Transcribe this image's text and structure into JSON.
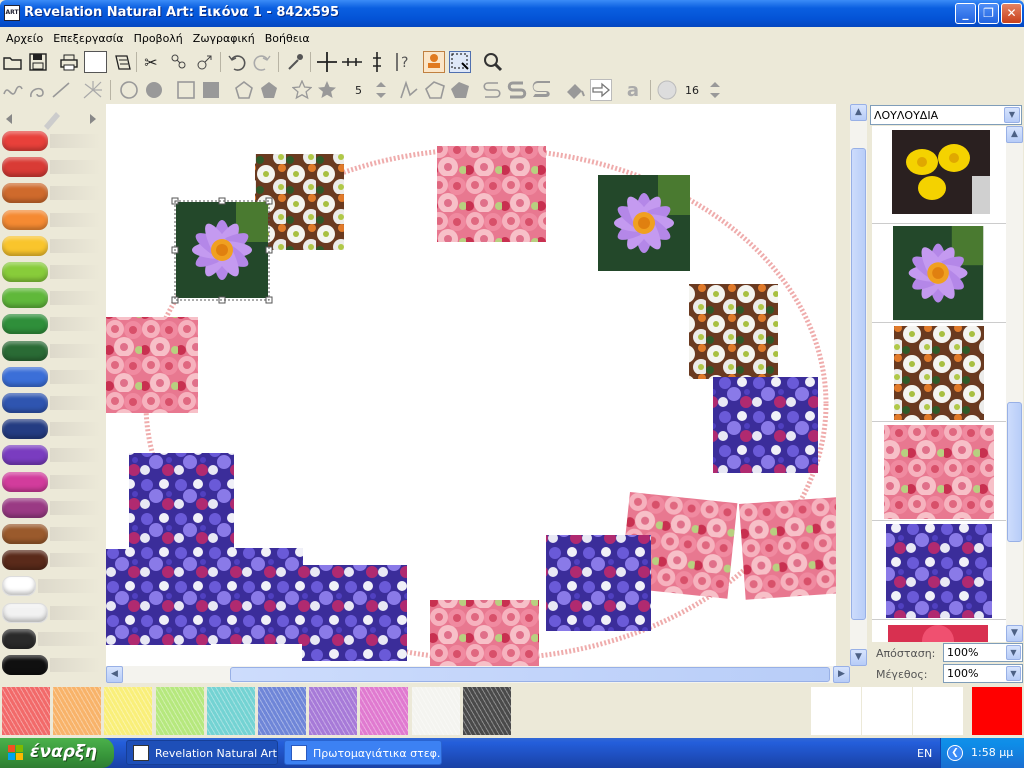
{
  "window": {
    "title": "Revelation Natural Art: Εικόνα 1 - 842x595",
    "app_icon_text": "ART"
  },
  "menu": [
    "Αρχείο",
    "Επεξεργασία",
    "Προβολή",
    "Ζωγραφική",
    "Βοήθεια"
  ],
  "toolbar2": {
    "brush_size": "5",
    "font_size": "16"
  },
  "right_panel": {
    "category": "ΛΟΥΛΟΥΔΙΑ",
    "distance_label": "Απόσταση:",
    "distance_value": "100%",
    "size_label": "Μέγεθος:",
    "size_value": "100%"
  },
  "crayon_colors": [
    "#e8403a",
    "#d93b35",
    "#cf6a2c",
    "#f58a32",
    "#f9c52c",
    "#88cc3a",
    "#60b83a",
    "#2f8f3a",
    "#2a6b35",
    "#3b6fd8",
    "#2f55b0",
    "#243c82",
    "#7a3cc0",
    "#d23c9c",
    "#9a3a84",
    "#9a5a2c",
    "#5a2a1a",
    "#ffffff",
    "#f2f2f2",
    "#2a2a2a",
    "#101010"
  ],
  "swatches": [
    "#f26a6a",
    "#f8b36a",
    "#f9ef7a",
    "#b6e87e",
    "#74d3d3",
    "#6f86d8",
    "#a77ad8",
    "#e07ad0",
    "#f4f4f0",
    "#4a4a4a"
  ],
  "bottom_right": {
    "white_slots": 3,
    "current_color": "#ff0000"
  },
  "taskbar": {
    "start_label": "έναρξη",
    "tasks": [
      "Revelation Natural Art",
      "Πρωτομαγιάτικα στεφ..."
    ],
    "language": "EN",
    "clock": "1:58 μμ"
  }
}
